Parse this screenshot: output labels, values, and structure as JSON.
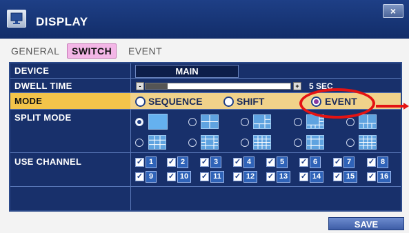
{
  "window": {
    "title": "DISPLAY",
    "close_label": "×"
  },
  "tabs": [
    {
      "label": "GENERAL",
      "active": false
    },
    {
      "label": "SWITCH",
      "active": true
    },
    {
      "label": "EVENT",
      "active": false
    }
  ],
  "rows": {
    "device": {
      "label": "DEVICE",
      "value": "MAIN"
    },
    "dwell": {
      "label": "DWELL TIME",
      "value": "5 SEC",
      "minus": "-",
      "plus": "+",
      "fill_percent": 15
    },
    "mode": {
      "label": "MODE",
      "options": [
        "SEQUENCE",
        "SHIFT",
        "EVENT"
      ],
      "selected": "EVENT"
    },
    "split": {
      "label": "SPLIT MODE",
      "selected_index": 0
    },
    "channels": {
      "label": "USE CHANNEL",
      "values": [
        "1",
        "2",
        "3",
        "4",
        "5",
        "6",
        "7",
        "8",
        "9",
        "10",
        "11",
        "12",
        "13",
        "14",
        "15",
        "16"
      ]
    }
  },
  "buttons": {
    "save_label": "SAVE"
  },
  "colors": {
    "accent": "#18306b",
    "mode_highlight": "#f0d28a",
    "annotation": "#e41313"
  }
}
